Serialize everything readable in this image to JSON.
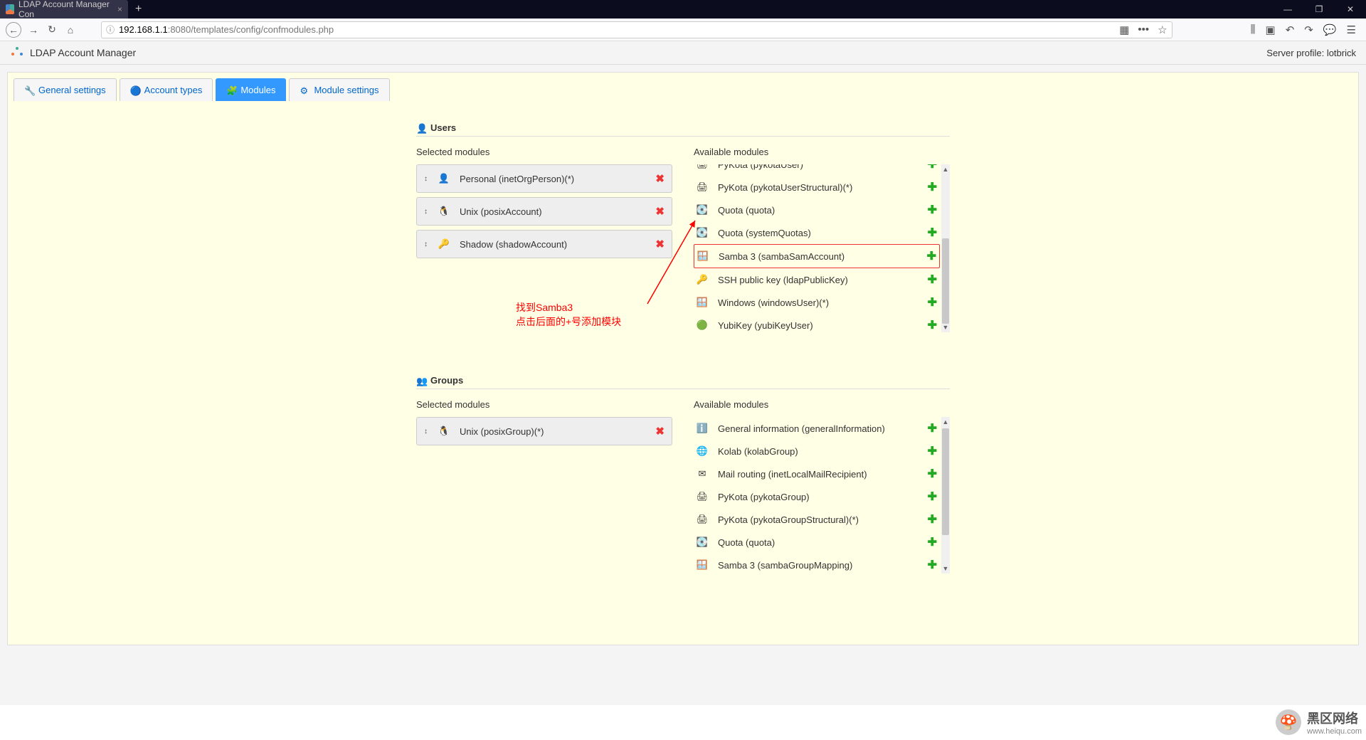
{
  "browser": {
    "tab_title": "LDAP Account Manager Con",
    "url_host": "192.168.1.1",
    "url_rest": ":8080/templates/config/confmodules.php"
  },
  "header": {
    "app_name": "LDAP Account Manager",
    "server_profile": "Server profile: lotbrick"
  },
  "tabs": [
    {
      "label": "General settings"
    },
    {
      "label": "Account types"
    },
    {
      "label": "Modules"
    },
    {
      "label": "Module settings"
    }
  ],
  "users": {
    "title": "Users",
    "selected_label": "Selected modules",
    "available_label": "Available modules",
    "selected": [
      {
        "label": "Personal (inetOrgPerson)(*)",
        "icon": "person"
      },
      {
        "label": "Unix (posixAccount)",
        "icon": "penguin"
      },
      {
        "label": "Shadow (shadowAccount)",
        "icon": "key"
      }
    ],
    "available": [
      {
        "label": "PyKota (pykotaUser)",
        "icon": "printer"
      },
      {
        "label": "PyKota (pykotaUserStructural)(*)",
        "icon": "printer"
      },
      {
        "label": "Quota (quota)",
        "icon": "disk"
      },
      {
        "label": "Quota (systemQuotas)",
        "icon": "disk"
      },
      {
        "label": "Samba 3 (sambaSamAccount)",
        "icon": "windows",
        "highlighted": true
      },
      {
        "label": "SSH public key (ldapPublicKey)",
        "icon": "key"
      },
      {
        "label": "Windows (windowsUser)(*)",
        "icon": "windows"
      },
      {
        "label": "YubiKey (yubiKeyUser)",
        "icon": "yubi"
      }
    ]
  },
  "groups": {
    "title": "Groups",
    "selected_label": "Selected modules",
    "available_label": "Available modules",
    "selected": [
      {
        "label": "Unix (posixGroup)(*)",
        "icon": "penguin"
      }
    ],
    "available": [
      {
        "label": "General information (generalInformation)",
        "icon": "info"
      },
      {
        "label": "Kolab (kolabGroup)",
        "icon": "kolab"
      },
      {
        "label": "Mail routing (inetLocalMailRecipient)",
        "icon": "mail"
      },
      {
        "label": "PyKota (pykotaGroup)",
        "icon": "printer"
      },
      {
        "label": "PyKota (pykotaGroupStructural)(*)",
        "icon": "printer"
      },
      {
        "label": "Quota (quota)",
        "icon": "disk"
      },
      {
        "label": "Samba 3 (sambaGroupMapping)",
        "icon": "windows"
      }
    ]
  },
  "annotation": {
    "line1": "找到Samba3",
    "line2": "点击后面的+号添加模块"
  },
  "watermark": {
    "title": "黑区网络",
    "url": "www.heiqu.com"
  }
}
